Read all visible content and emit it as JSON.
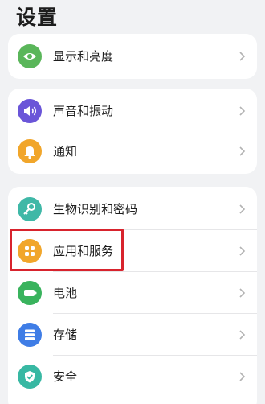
{
  "header": {
    "title": "设置"
  },
  "colors": {
    "display": "#5ab65a",
    "sound": "#6a55d8",
    "notify": "#f1a62b",
    "biometric": "#3fb8a7",
    "apps": "#f1a62b",
    "battery": "#39b35d",
    "storage": "#3f7de6",
    "security": "#38b8a3"
  },
  "groups": [
    {
      "items": [
        {
          "label": "显示和亮度",
          "icon": "eye-icon"
        }
      ]
    },
    {
      "items": [
        {
          "label": "声音和振动",
          "icon": "speaker-icon"
        },
        {
          "label": "通知",
          "icon": "bell-icon"
        }
      ]
    },
    {
      "items": [
        {
          "label": "生物识别和密码",
          "icon": "key-icon"
        },
        {
          "label": "应用和服务",
          "icon": "apps-grid-icon"
        },
        {
          "label": "电池",
          "icon": "battery-icon"
        },
        {
          "label": "存储",
          "icon": "storage-icon"
        },
        {
          "label": "安全",
          "icon": "shield-icon"
        }
      ]
    }
  ]
}
